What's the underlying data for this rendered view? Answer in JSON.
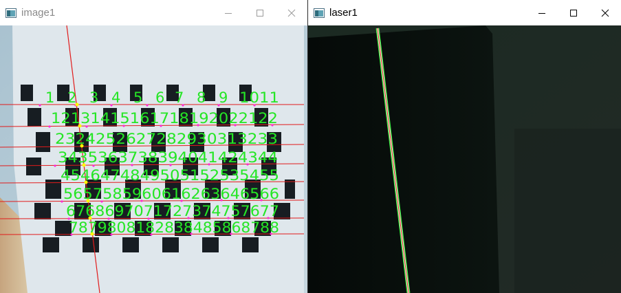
{
  "windows": [
    {
      "title": "image1",
      "icon": "app-window-icon"
    },
    {
      "title": "laser1",
      "icon": "app-window-icon"
    }
  ],
  "controls": {
    "minimize": "minimize-icon",
    "maximize": "maximize-icon",
    "close": "close-icon"
  },
  "colors": {
    "detected_point": "#ffff00",
    "corner_marker": "#ff2bd6",
    "row_line": "#e11b1b",
    "laser_line": "#e11b1b",
    "label_text": "#25e625"
  },
  "labels": {
    "rows": [
      [
        "1",
        "2",
        "3",
        "4",
        "5",
        "6",
        "7",
        "8",
        "9",
        "1011"
      ],
      [
        "12131415161718192022122"
      ],
      [
        "2324252627282930313233"
      ],
      [
        "3435363738394041424344"
      ],
      [
        "4546474849505152535455"
      ],
      [
        "5657585960616263646566"
      ],
      [
        "6768697071727374757677"
      ],
      [
        "7879808182838485868788"
      ]
    ]
  }
}
